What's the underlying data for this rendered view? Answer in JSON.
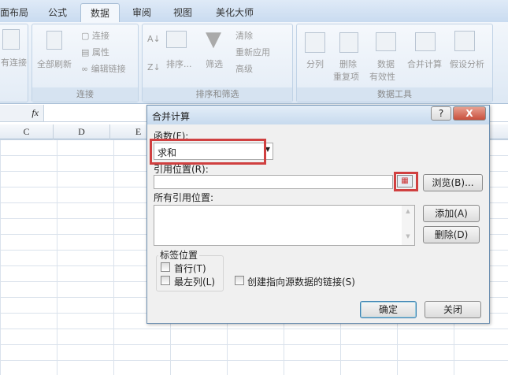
{
  "ribbon_tabs": [
    "面布局",
    "公式",
    "数据",
    "审阅",
    "视图",
    "美化大师"
  ],
  "active_tab": "数据",
  "ribbon": {
    "conn_group": {
      "label": "连接",
      "existing": "有连接",
      "refresh_all": "全部刷新",
      "connections": "连接",
      "properties": "属性",
      "edit_links": "编辑链接"
    },
    "sort_group": {
      "label": "排序和筛选",
      "sort": "排序...",
      "filter": "筛选",
      "clear": "清除",
      "reapply": "重新应用",
      "advanced": "高级"
    },
    "tools_group": {
      "label": "数据工具",
      "split": "分列",
      "remove_dup_1": "删除",
      "remove_dup_2": "重复项",
      "validation_1": "数据",
      "validation_2": "有效性",
      "consolidate": "合并计算",
      "whatif": "假设分析"
    }
  },
  "formula_bar": {
    "fx": "fx"
  },
  "columns": [
    "C",
    "D",
    "E"
  ],
  "dialog": {
    "title": "合并计算",
    "help": "?",
    "close": "X",
    "function_label": "函数(F):",
    "function_value": "求和",
    "reference_label": "引用位置(R):",
    "reference_value": "",
    "browse": "浏览(B)...",
    "all_refs_label": "所有引用位置:",
    "add": "添加(A)",
    "delete": "删除(D)",
    "labels_group": "标签位置",
    "top_row": "首行(T)",
    "left_col": "最左列(L)",
    "create_links": "创建指向源数据的链接(S)",
    "ok": "确定",
    "close_btn": "关闭"
  }
}
